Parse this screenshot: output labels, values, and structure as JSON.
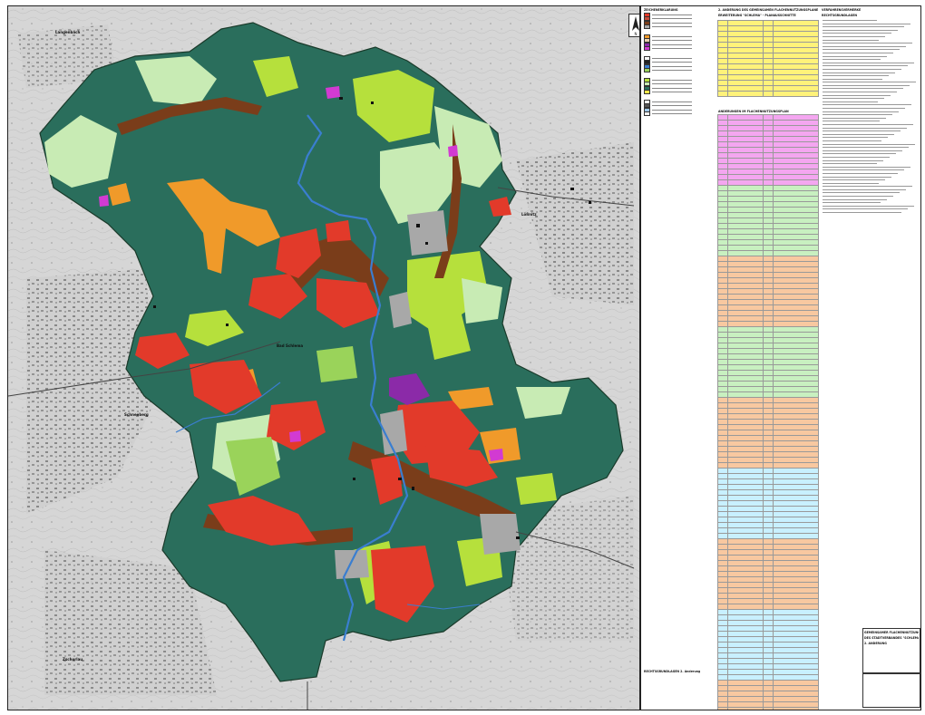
{
  "map": {
    "place_labels": {
      "center": "Bad Schlema",
      "east": "Lößnitz",
      "southwest": "Zschorlau",
      "west": "Schneeberg",
      "northwest": "Langenbach"
    },
    "colors": {
      "forest": "#2a6e5c",
      "agriculture": "#c8ebb4",
      "grassland": "#b6e03c",
      "residential": "#e23a2a",
      "mixed": "#7a3d1a",
      "commercial": "#a8a8a8",
      "special": "#f09a2a",
      "green_space": "#9ad35a",
      "water": "#3a7ed0",
      "purple": "#8b2aa8",
      "magenta": "#d23ad2",
      "background": "#d9d9d9"
    }
  },
  "side": {
    "col1_title": "ZEICHENERKLÄRUNG",
    "col2_title": "2. ÄNDERUNG DES GEMEINSAMEN FLÄCHENNUTZUNGSPLANES",
    "col2_subtitle": "ERWEITERUNG \"SCHLEMA\" - PLANAUSSCHNITTE",
    "col2_table_title": "ÄNDERUNGEN IM FLÄCHENNUTZUNGSPLAN",
    "col3_title": "VERFAHRENSVERMERKE",
    "col3_subtitle": "RECHTSGRUNDLAGEN",
    "col1_footer": "RECHTSGRUNDLAGEN 2. Änderung",
    "stamp_title": "GEMEINSAMER FLÄCHENNUTZUNGSPLAN",
    "stamp_line2": "DES STADTVERBANDES \"SCHLEMA\"",
    "stamp_line3": "2. ÄNDERUNG"
  },
  "legend": {
    "swatches": [
      {
        "color": "#e23a2a"
      },
      {
        "color": "#c94a3a"
      },
      {
        "color": "#7a3d1a"
      },
      {
        "color": "#a8a8a8"
      },
      {
        "color": "#f09a2a"
      },
      {
        "color": "#e8d0b0"
      },
      {
        "color": "#8b2aa8"
      },
      {
        "color": "#d23ad2"
      },
      {
        "color": "#ffffff"
      },
      {
        "color": "#222222"
      },
      {
        "color": "#3a7ed0"
      },
      {
        "color": "#9ad35a"
      },
      {
        "color": "#b6e03c"
      },
      {
        "color": "#c8ebb4"
      },
      {
        "color": "#2a6e5c"
      },
      {
        "color": "#ffe94a"
      },
      {
        "color": "#ffffff"
      },
      {
        "color": "#555555"
      },
      {
        "color": "#a0c8e8"
      },
      {
        "color": "#f0f0f0"
      }
    ]
  }
}
